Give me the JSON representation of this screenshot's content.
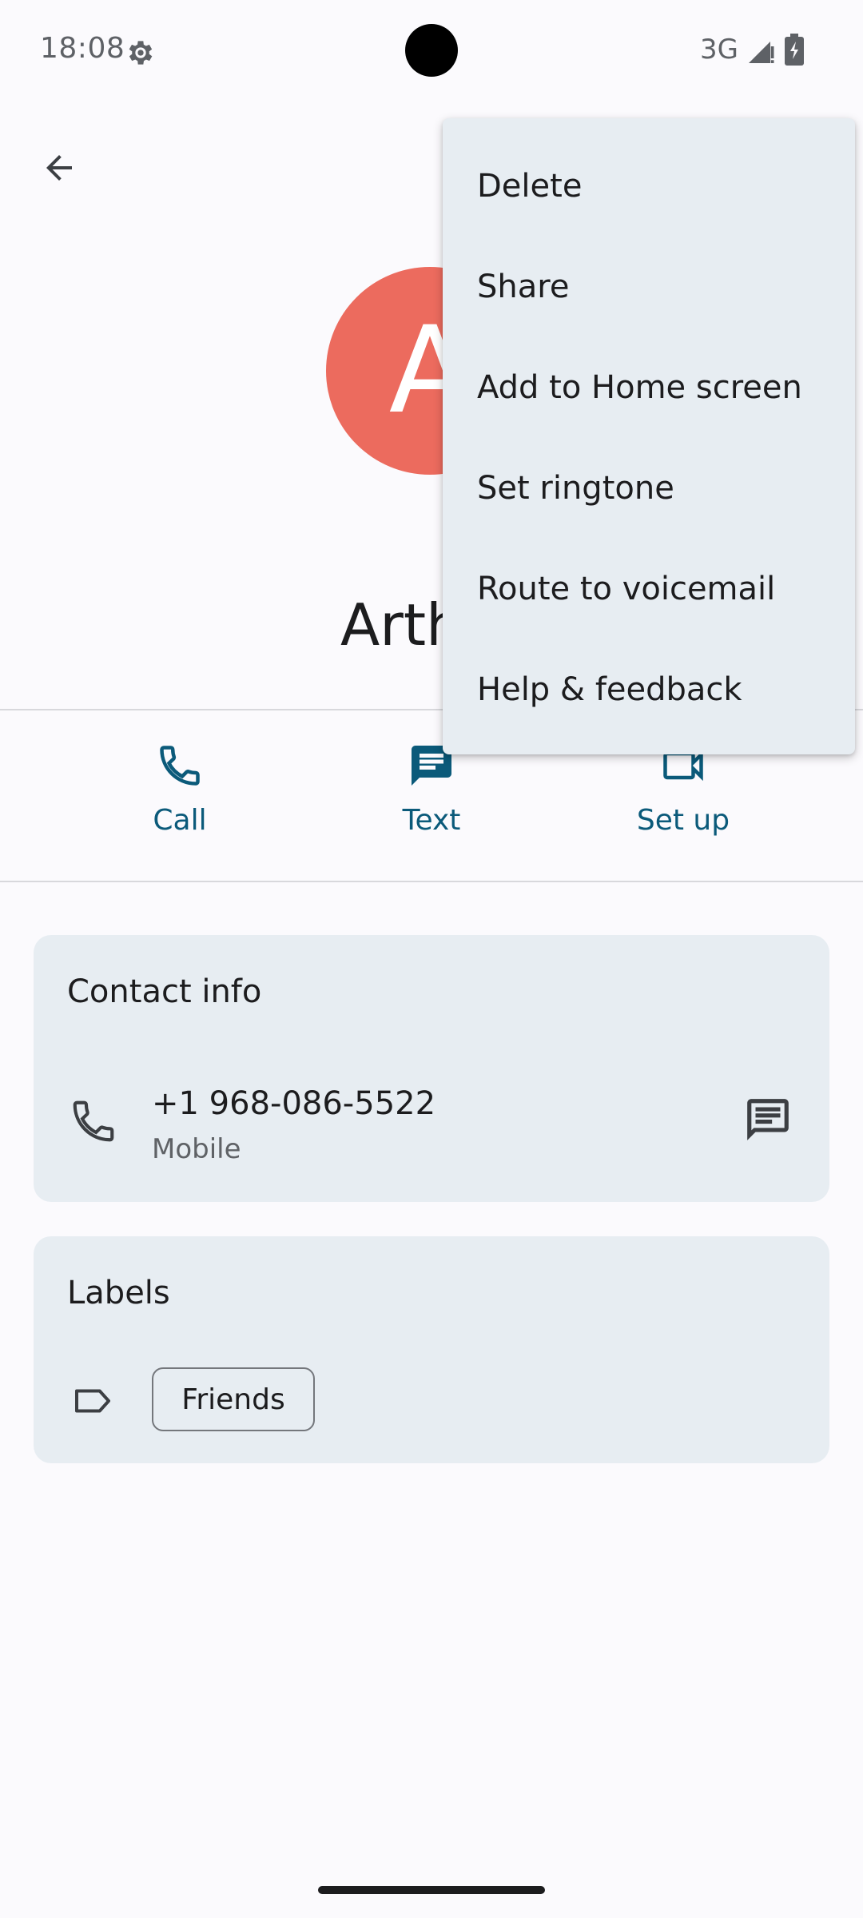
{
  "status_bar": {
    "time": "18:08",
    "network": "3G",
    "icons": [
      "settings-gear-icon",
      "signal-icon",
      "battery-charging-icon"
    ]
  },
  "header": {
    "back_icon": "arrow-back-icon"
  },
  "contact": {
    "avatar_letter": "A",
    "avatar_color": "#ec6b5e",
    "name": "Arthur"
  },
  "actions": [
    {
      "label": "Call",
      "icon": "phone-icon"
    },
    {
      "label": "Text",
      "icon": "message-icon"
    },
    {
      "label": "Set up",
      "icon": "video-camera-icon"
    }
  ],
  "contact_info": {
    "title": "Contact info",
    "phone_number": "+1 968-086-5522",
    "phone_type": "Mobile",
    "phone_icon": "phone-icon",
    "message_icon": "message-icon"
  },
  "labels_card": {
    "title": "Labels",
    "label_icon": "label-tag-icon",
    "chip": "Friends"
  },
  "menu": {
    "items": [
      "Delete",
      "Share",
      "Add to Home screen",
      "Set ringtone",
      "Route to voicemail",
      "Help & feedback"
    ]
  },
  "colors": {
    "accent": "#0b5a7a",
    "card_bg": "#e7edf2",
    "page_bg": "#fbfafd"
  }
}
